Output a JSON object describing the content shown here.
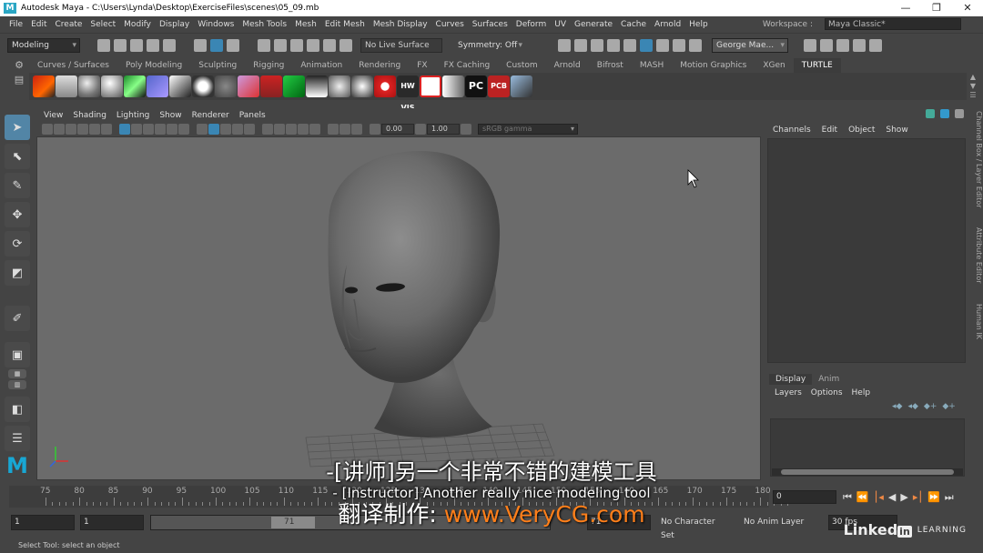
{
  "window": {
    "title": "Autodesk Maya - C:\\Users\\Lynda\\Desktop\\ExerciseFiles\\scenes\\05_09.mb",
    "logo": "M"
  },
  "menubar": {
    "items": [
      "File",
      "Edit",
      "Create",
      "Select",
      "Modify",
      "Display",
      "Windows",
      "Mesh Tools",
      "Mesh",
      "Edit Mesh",
      "Mesh Display",
      "Curves",
      "Surfaces",
      "Deform",
      "UV",
      "Generate",
      "Cache",
      "Arnold",
      "Help"
    ],
    "workspace_label": "Workspace :",
    "workspace_value": "Maya Classic*"
  },
  "statusline": {
    "menuset": "Modeling",
    "live_surface": "No Live Surface",
    "symmetry": "Symmetry: Off",
    "user": "George Mae..."
  },
  "shelf": {
    "tabs": [
      "Curves / Surfaces",
      "Poly Modeling",
      "Sculpting",
      "Rigging",
      "Animation",
      "Rendering",
      "FX",
      "FX Caching",
      "Custom",
      "Arnold",
      "Bifrost",
      "MASH",
      "Motion Graphics",
      "XGen",
      "TURTLE"
    ],
    "active_tab": "TURTLE",
    "icon_labels": [
      "HW VIS",
      "PC",
      "PCB"
    ]
  },
  "viewport": {
    "menu": [
      "View",
      "Shading",
      "Lighting",
      "Show",
      "Renderer",
      "Panels"
    ],
    "exposure": "0.00",
    "gamma": "1.00",
    "color_space": "sRGB gamma"
  },
  "channelbox": {
    "menu": [
      "Channels",
      "Edit",
      "Object",
      "Show"
    ]
  },
  "side_tabs": [
    "Channel Box / Layer Editor",
    "Attribute Editor",
    "Human IK"
  ],
  "layer_editor": {
    "tabs": [
      "Display",
      "Anim"
    ],
    "menu": [
      "Layers",
      "Options",
      "Help"
    ]
  },
  "timeline": {
    "labels": [
      "75",
      "80",
      "85",
      "90",
      "95",
      "100",
      "105",
      "110",
      "115",
      "120",
      "125",
      "130",
      "135",
      "140",
      "145",
      "150",
      "155",
      "160",
      "165",
      "170",
      "175",
      "180"
    ],
    "current_frame": "0"
  },
  "range": {
    "start": "1",
    "start_inner": "1",
    "end_inner": "71",
    "end_field": "71",
    "character_set": "No Character Set",
    "anim_layer": "No Anim Layer",
    "fps": "30 fps"
  },
  "helpline": "Select Tool: select an object",
  "subtitles": {
    "chinese": "-[讲师]另一个非常不错的建模工具",
    "english": "- [Instructor] Another really nice modeling tool",
    "credit_prefix": "翻译制作: ",
    "credit_url": "www.VeryCG.com"
  },
  "watermark": {
    "brand": "Linked",
    "in": "in",
    "suffix": "LEARNING"
  }
}
